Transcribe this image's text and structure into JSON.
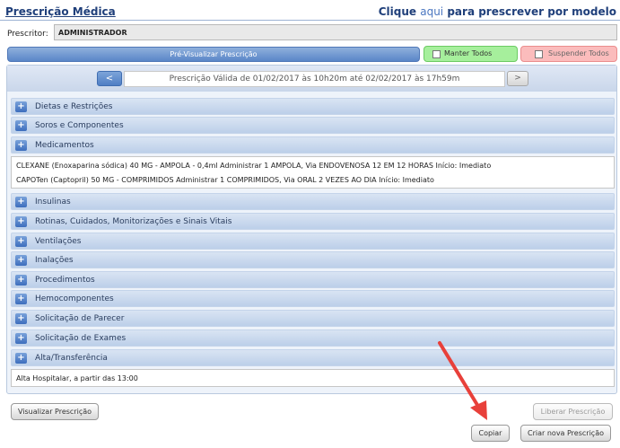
{
  "header": {
    "title": "Prescrição Médica",
    "model_prefix": "Clique ",
    "model_link": "aqui",
    "model_suffix": " para prescrever por modelo"
  },
  "prescritor": {
    "label": "Prescritor:",
    "value": "ADMINISTRADOR"
  },
  "toolbar": {
    "preview_label": "Pré-Visualizar Prescrição",
    "keep_all_label": "Manter Todos",
    "suspend_all_label": "Suspender Todos"
  },
  "navigation": {
    "prev_label": "<",
    "next_label": ">",
    "validity_text": "Prescrição Válida de 01/02/2017 às 10h20m até 02/02/2017 às 17h59m"
  },
  "sections": [
    {
      "label": "Dietas e Restrições"
    },
    {
      "label": "Soros e Componentes"
    },
    {
      "label": "Medicamentos"
    },
    {
      "label": "Insulinas"
    },
    {
      "label": "Rotinas, Cuidados, Monitorizações e Sinais Vitais"
    },
    {
      "label": "Ventilações"
    },
    {
      "label": "Inalações"
    },
    {
      "label": "Procedimentos"
    },
    {
      "label": "Hemocomponentes"
    },
    {
      "label": "Solicitação de Parecer"
    },
    {
      "label": "Solicitação de Exames"
    },
    {
      "label": "Alta/Transferência"
    }
  ],
  "medications": [
    "CLEXANE (Enoxaparina sódica) 40 MG - AMPOLA - 0,4ml Administrar 1 AMPOLA, Via ENDOVENOSA 12 EM 12 HORAS Início: Imediato",
    "CAPOTen (Captopril) 50 MG - COMPRIMIDOS Administrar 1 COMPRIMIDOS, Via ORAL 2 VEZES AO DIA Início: Imediato"
  ],
  "discharge": [
    "Alta Hospitalar, a partir das 13:00"
  ],
  "footer": {
    "view_label": "Visualizar Prescrição",
    "release_label": "Liberar Prescrição",
    "copy_label": "Copiar",
    "new_label": "Criar nova Prescrição"
  },
  "colors": {
    "accent": "#1f3f7a",
    "keep_green": "#a6ef9c",
    "suspend_red": "#fbbcbc",
    "arrow_red": "#e8403a"
  }
}
